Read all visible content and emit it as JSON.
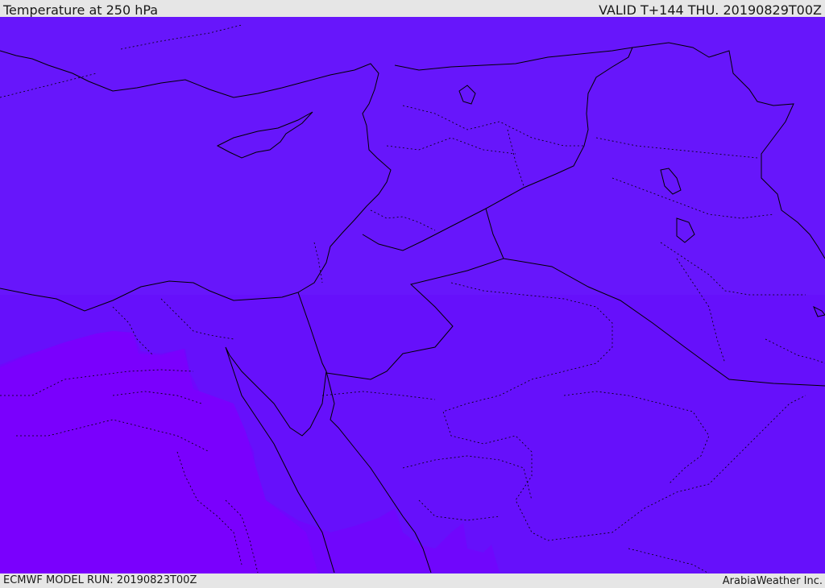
{
  "header": {
    "title": "Temperature at 250 hPa",
    "valid": "VALID T+144 THU. 20190829T00Z"
  },
  "footer": {
    "model_run": "ECMWF MODEL RUN: 20190823T00Z",
    "credit": "ArabiaWeather Inc."
  },
  "map": {
    "fill_colors": {
      "main": "#6716fb",
      "lower": "#6610fb",
      "warm": "#7a00fd",
      "mid": "#7006fc"
    },
    "border_color": "#000000"
  }
}
